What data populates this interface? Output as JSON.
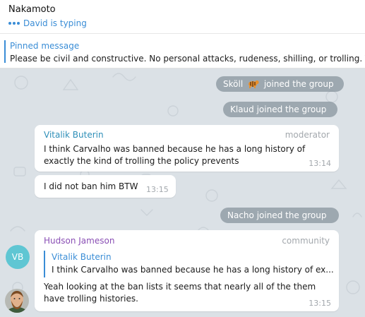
{
  "header": {
    "title": "Nakamoto",
    "typing_status": "David is typing"
  },
  "pinned": {
    "label": "Pinned message",
    "text": "Please be civil and constructive. No personal attacks, rudeness, shilling, or trolling. The"
  },
  "colors": {
    "accent": "#3a8dd6",
    "vitalik_name": "#2e8fb8",
    "hudson_name": "#8a4fb5",
    "chat_background": "#dbe1e6",
    "avatar_vb": "#5fc6d3"
  },
  "messages": {
    "service_skoll_name": "Sköll",
    "service_skoll_icon": "tiger-emoji",
    "service_skoll_suffix": "joined the group",
    "service_klaud": "Klaud joined the group",
    "vitalik_name": "Vitalik Buterin",
    "vitalik_role": "moderator",
    "vitalik_text_1": "I think Carvalho was banned because he has a long history of",
    "vitalik_text_2": "exactly the kind of trolling the policy prevents",
    "vitalik_time": "13:14",
    "vb_avatar_initials": "VB",
    "vb_text": "I did not ban him BTW",
    "vb_time": "13:15",
    "service_nacho": "Nacho joined the group",
    "hudson_name": "Hudson Jameson",
    "hudson_role": "community",
    "reply_name": "Vitalik Buterin",
    "reply_text": "I think Carvalho was banned because he has a long history of ex...",
    "hudson_text_1": "Yeah looking at the ban lists it seems that nearly all of the them",
    "hudson_text_2": "have trolling histories.",
    "hudson_time": "13:15"
  }
}
